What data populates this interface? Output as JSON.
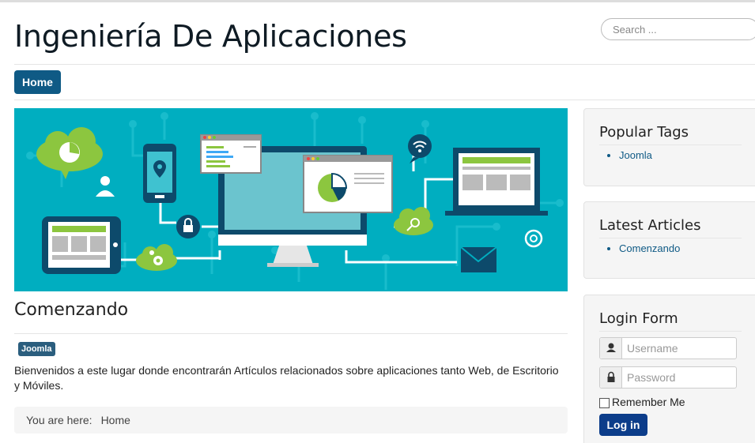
{
  "header": {
    "site_title": "Ingeniería De Aplicaciones",
    "search_placeholder": "Search ..."
  },
  "nav": {
    "home_label": "Home"
  },
  "banner": {
    "background_color": "#00aec0",
    "accent_green": "#8cc63f",
    "dark_navy": "#0d4a6b"
  },
  "article": {
    "title": "Comenzando",
    "tag": "Joomla",
    "body": "Bienvenidos a este lugar donde encontrarán Artículos relacionados sobre aplicaciones tanto Web, de Escritorio y Móviles."
  },
  "breadcrumb": {
    "prefix": "You are here:",
    "current": "Home"
  },
  "sidebar": {
    "popular_tags": {
      "title": "Popular Tags",
      "items": [
        "Joomla"
      ]
    },
    "latest_articles": {
      "title": "Latest Articles",
      "items": [
        "Comenzando"
      ]
    },
    "login_form": {
      "title": "Login Form",
      "username_placeholder": "Username",
      "password_placeholder": "Password",
      "remember_label": "Remember Me",
      "login_label": "Log in"
    }
  },
  "colors": {
    "primary": "#0f5a85",
    "login_button": "#0c3d8a",
    "link": "#0f5a85"
  }
}
